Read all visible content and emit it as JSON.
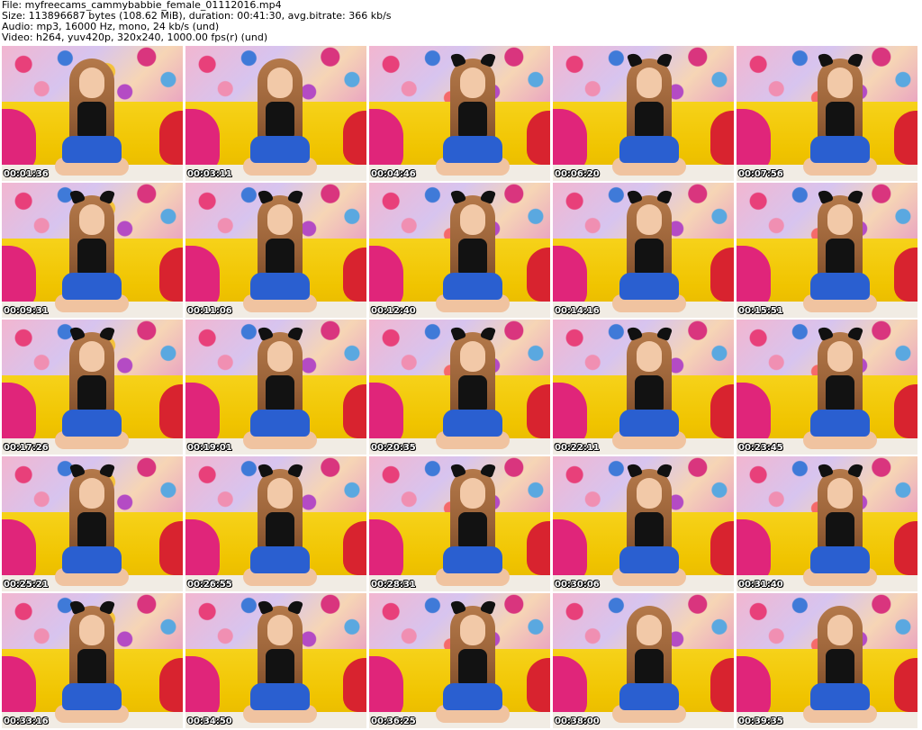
{
  "header": {
    "file_line": "File: myfreecams_cammybabbie_female_01112016.mp4",
    "size_line": "Size: 113896687 bytes (108.62 MiB), duration: 00:41:30, avg.bitrate: 366 kb/s",
    "audio_line": "Audio: mp3, 16000 Hz, mono, 24 kb/s (und)",
    "video_line": "Video: h264, yuv420p, 320x240, 1000.00 fps(r) (und)"
  },
  "thumbnails": [
    {
      "time": "00:01:36",
      "ears": false
    },
    {
      "time": "00:03:11",
      "ears": false
    },
    {
      "time": "00:04:46",
      "ears": true
    },
    {
      "time": "00:06:20",
      "ears": true
    },
    {
      "time": "00:07:56",
      "ears": true
    },
    {
      "time": "00:09:31",
      "ears": true
    },
    {
      "time": "00:11:06",
      "ears": true
    },
    {
      "time": "00:12:40",
      "ears": true
    },
    {
      "time": "00:14:16",
      "ears": true
    },
    {
      "time": "00:15:51",
      "ears": true
    },
    {
      "time": "00:17:26",
      "ears": true
    },
    {
      "time": "00:19:01",
      "ears": true
    },
    {
      "time": "00:20:35",
      "ears": true
    },
    {
      "time": "00:22:11",
      "ears": true
    },
    {
      "time": "00:23:45",
      "ears": true
    },
    {
      "time": "00:25:21",
      "ears": true
    },
    {
      "time": "00:26:55",
      "ears": true
    },
    {
      "time": "00:28:31",
      "ears": true
    },
    {
      "time": "00:30:06",
      "ears": true
    },
    {
      "time": "00:31:40",
      "ears": true
    },
    {
      "time": "00:33:16",
      "ears": true
    },
    {
      "time": "00:34:50",
      "ears": true
    },
    {
      "time": "00:36:25",
      "ears": true
    },
    {
      "time": "00:38:00",
      "ears": false
    },
    {
      "time": "00:39:35",
      "ears": false
    }
  ],
  "colors": {
    "background": "#ffffff",
    "header_text": "#000000",
    "timestamp_text": "#ffffff",
    "timestamp_outline": "#000000",
    "sofa": "#f4d000",
    "skirt": "#2a5fd0",
    "top": "#121212"
  }
}
